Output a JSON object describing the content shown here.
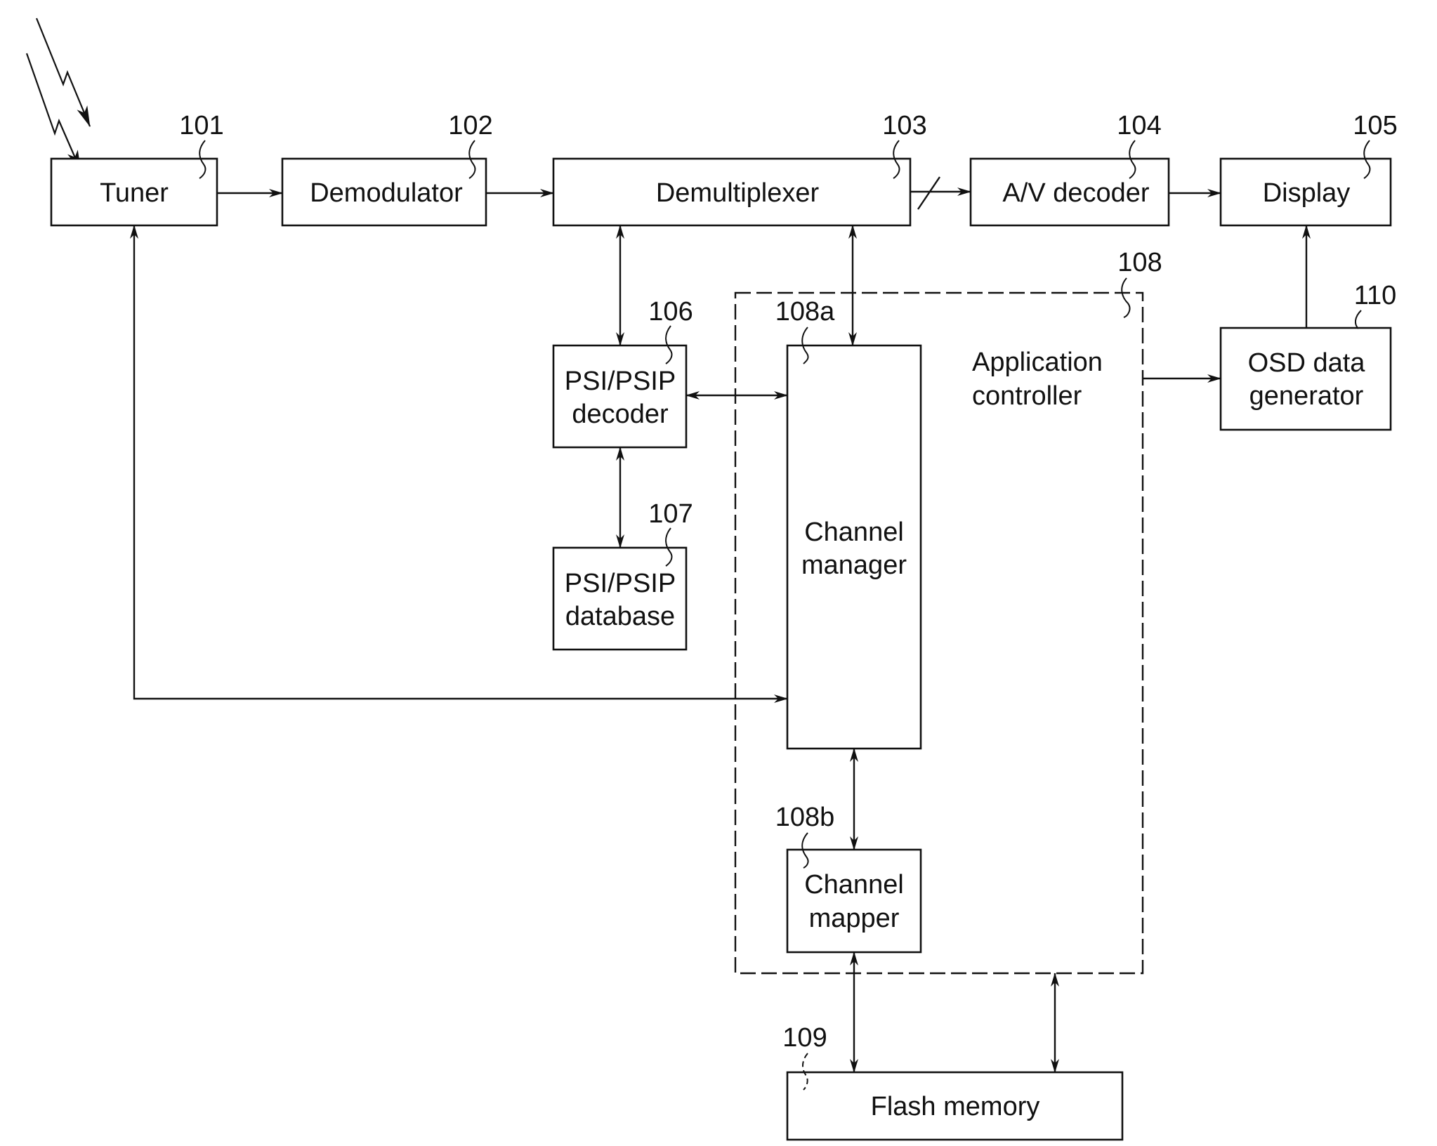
{
  "figure": {
    "type": "block-diagram",
    "antenna_icon": "lightning-bolt-signal-icon",
    "colors": {
      "ink": "#111111",
      "background": "#ffffff"
    }
  },
  "blocks": {
    "tuner": {
      "ref": "101",
      "lines": [
        "Tuner"
      ]
    },
    "demodulator": {
      "ref": "102",
      "lines": [
        "Demodulator"
      ]
    },
    "demultiplexer": {
      "ref": "103",
      "lines": [
        "Demultiplexer"
      ]
    },
    "av_decoder": {
      "ref": "104",
      "lines": [
        "A/V decoder"
      ]
    },
    "display": {
      "ref": "105",
      "lines": [
        "Display"
      ]
    },
    "psi_decoder": {
      "ref": "106",
      "lines": [
        "PSI/PSIP",
        "decoder"
      ]
    },
    "psi_database": {
      "ref": "107",
      "lines": [
        "PSI/PSIP",
        "database"
      ]
    },
    "app_controller": {
      "ref": "108",
      "lines": [
        "Application",
        "controller"
      ]
    },
    "channel_manager": {
      "ref": "108a",
      "lines": [
        "Channel",
        "manager"
      ]
    },
    "channel_mapper": {
      "ref": "108b",
      "lines": [
        "Channel",
        "mapper"
      ]
    },
    "flash_memory": {
      "ref": "109",
      "lines": [
        "Flash memory"
      ]
    },
    "osd_generator": {
      "ref": "110",
      "lines": [
        "OSD data",
        "generator"
      ]
    }
  },
  "connections": [
    {
      "from": "tuner",
      "to": "demodulator",
      "direction": "one-way"
    },
    {
      "from": "demodulator",
      "to": "demultiplexer",
      "direction": "one-way"
    },
    {
      "from": "demultiplexer",
      "to": "av_decoder",
      "direction": "one-way",
      "bus": true
    },
    {
      "from": "av_decoder",
      "to": "display",
      "direction": "one-way"
    },
    {
      "from": "demultiplexer",
      "to": "psi_decoder",
      "direction": "two-way"
    },
    {
      "from": "demultiplexer",
      "to": "channel_manager",
      "direction": "two-way"
    },
    {
      "from": "psi_decoder",
      "to": "channel_manager",
      "direction": "two-way"
    },
    {
      "from": "psi_decoder",
      "to": "psi_database",
      "direction": "two-way"
    },
    {
      "from": "channel_manager",
      "to": "tuner",
      "direction": "two-way"
    },
    {
      "from": "channel_manager",
      "to": "channel_mapper",
      "direction": "two-way"
    },
    {
      "from": "channel_mapper",
      "to": "flash_memory",
      "direction": "two-way"
    },
    {
      "from": "app_controller",
      "to": "flash_memory",
      "direction": "two-way"
    },
    {
      "from": "app_controller",
      "to": "osd_generator",
      "direction": "one-way"
    },
    {
      "from": "osd_generator",
      "to": "display",
      "direction": "one-way"
    }
  ]
}
